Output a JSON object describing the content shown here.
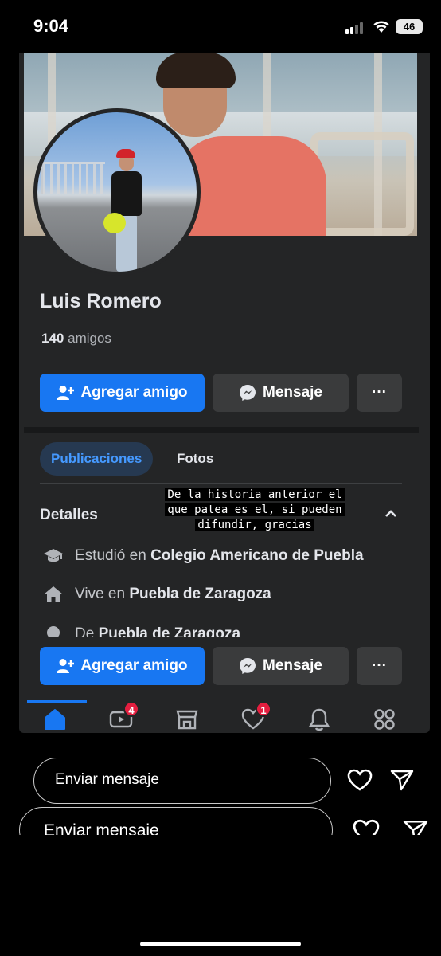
{
  "status_bar": {
    "time": "9:04",
    "battery": "46"
  },
  "profile": {
    "name": "Luis Romero",
    "friend_count": "140",
    "friend_label": "amigos"
  },
  "actions": {
    "add_friend": "Agregar amigo",
    "message": "Mensaje",
    "more": "···"
  },
  "tabs": [
    {
      "label": "Publicaciones",
      "active": true
    },
    {
      "label": "Fotos",
      "active": false
    }
  ],
  "details": {
    "title": "Detalles",
    "items": [
      {
        "icon": "graduation-cap-icon",
        "prefix": "Estudió en",
        "value": "Colegio Americano de Puebla"
      },
      {
        "icon": "house-icon",
        "prefix": "Vive en",
        "value": "Puebla de Zaragoza"
      },
      {
        "icon": "location-pin-icon",
        "prefix": "De",
        "value": "Puebla de Zaragoza"
      }
    ]
  },
  "story_caption": [
    "De la historia anterior el",
    "que patea es el, si pueden",
    "difundir, gracias"
  ],
  "bottom_nav": [
    {
      "icon": "home-icon",
      "badge": ""
    },
    {
      "icon": "video-icon",
      "badge": "4"
    },
    {
      "icon": "marketplace-icon",
      "badge": ""
    },
    {
      "icon": "dating-heart-icon",
      "badge": "1"
    },
    {
      "icon": "bell-icon",
      "badge": ""
    },
    {
      "icon": "menu-grid-icon",
      "badge": ""
    }
  ],
  "story_reply": {
    "placeholder_1": "Enviar mensaje",
    "placeholder_2": "Enviar mensaje"
  },
  "colors": {
    "accent": "#1877f2",
    "panel": "#242526",
    "button_secondary": "#3a3b3c",
    "badge": "#e41e3f"
  }
}
